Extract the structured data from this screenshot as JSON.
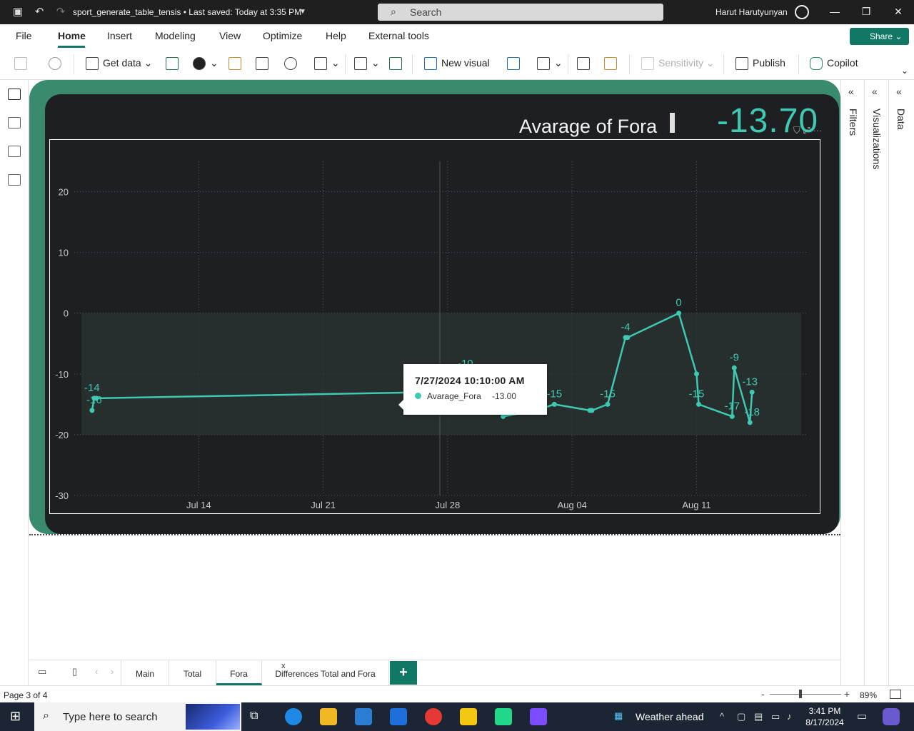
{
  "titlebar": {
    "file_title": "sport_generate_table_tensis • Last saved: Today at 3:35 PM",
    "search_placeholder": "Search",
    "user_name": "Harut Harutyunyan"
  },
  "menu": {
    "items": [
      "File",
      "Home",
      "Insert",
      "Modeling",
      "View",
      "Optimize",
      "Help",
      "External tools"
    ],
    "active": "Home",
    "share_label": "Share"
  },
  "ribbon": {
    "get_data": "Get data",
    "new_visual": "New visual",
    "sensitivity": "Sensitivity",
    "publish": "Publish",
    "copilot": "Copilot"
  },
  "card": {
    "title": "Avarage of Fora",
    "kpi_value": "-13.70"
  },
  "chart_data": {
    "type": "line",
    "series": [
      {
        "name": "Avarage_Fora",
        "x": [
          "2024-07-08",
          "2024-07-08",
          "2024-07-08",
          "2024-07-27",
          "2024-07-29",
          "2024-07-31",
          "2024-07-31",
          "2024-08-02",
          "2024-08-03",
          "2024-08-05",
          "2024-08-05",
          "2024-08-06",
          "2024-08-07",
          "2024-08-07",
          "2024-08-10",
          "2024-08-11",
          "2024-08-11",
          "2024-08-13",
          "2024-08-13",
          "2024-08-14",
          "2024-08-14"
        ],
        "values": [
          -16,
          -14,
          -14,
          -13,
          -10,
          -13,
          -17,
          -16,
          -15,
          -16,
          -16,
          -15,
          -4,
          -4,
          0,
          -10,
          -15,
          -17,
          -9,
          -18,
          -13
        ]
      }
    ],
    "labels": [
      {
        "x": "2024-07-08",
        "text": "-14",
        "value": -14
      },
      {
        "x": "2024-07-08",
        "text": "-16",
        "value": -16
      },
      {
        "x": "2024-07-29",
        "text": "-10",
        "value": -10
      },
      {
        "x": "2024-07-31",
        "text": "-13",
        "value": -13
      },
      {
        "x": "2024-07-31",
        "text": "-17",
        "value": -17
      },
      {
        "x": "2024-08-03",
        "text": "-15",
        "value": -15
      },
      {
        "x": "2024-08-06",
        "text": "-15",
        "value": -15
      },
      {
        "x": "2024-08-07",
        "text": "-4",
        "value": -4
      },
      {
        "x": "2024-08-10",
        "text": "0",
        "value": 0
      },
      {
        "x": "2024-08-11",
        "text": "-15",
        "value": -15
      },
      {
        "x": "2024-08-13",
        "text": "-17",
        "value": -17
      },
      {
        "x": "2024-08-13",
        "text": "-9",
        "value": -9
      },
      {
        "x": "2024-08-14",
        "text": "-13",
        "value": -13
      },
      {
        "x": "2024-08-14",
        "text": "-18",
        "value": -18
      }
    ],
    "x_ticks": [
      "Jul 14",
      "Jul 21",
      "Jul 28",
      "Aug 04",
      "Aug 11"
    ],
    "x_tick_dates": [
      "2024-07-14",
      "2024-07-21",
      "2024-07-28",
      "2024-08-04",
      "2024-08-11"
    ],
    "y_ticks": [
      20,
      10,
      0,
      -10,
      -20,
      -30
    ],
    "ylim": [
      -30,
      25
    ],
    "xlim": [
      "2024-07-07",
      "2024-08-16"
    ],
    "band": [
      -20,
      0
    ],
    "grid": true,
    "line_color": "#3fc8b2",
    "title": "",
    "xlabel": "",
    "ylabel": ""
  },
  "tooltip": {
    "title": "7/27/2024 10:10:00 AM",
    "series_name": "Avarage_Fora",
    "value": "-13.00"
  },
  "pages": {
    "tabs": [
      "Main",
      "Total",
      "Fora",
      "Differences Total and Fora"
    ],
    "active": "Fora",
    "add_label": "+"
  },
  "panes": {
    "filters": "Filters",
    "visualizations": "Visualizations",
    "data": "Data"
  },
  "status": {
    "page_label": "Page 3 of 4",
    "zoom": "89%"
  },
  "taskbar": {
    "search_placeholder": "Type here to search",
    "weather": "Weather ahead",
    "time": "3:41 PM",
    "date": "8/17/2024"
  },
  "colors": {
    "accent": "#117865",
    "frame": "#3a8b6e",
    "card_bg": "#1e1f23",
    "line": "#3fc8b2"
  }
}
